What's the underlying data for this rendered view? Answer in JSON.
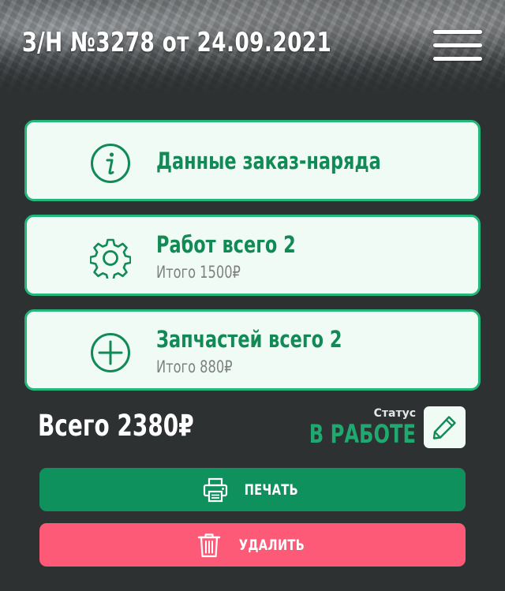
{
  "header": {
    "title": "З/Н №3278 от 24.09.2021",
    "menu_icon": "hamburger-menu-icon"
  },
  "cards": [
    {
      "title": "Данные заказ-наряда",
      "subtitle": "",
      "icon": "info-icon"
    },
    {
      "title": "Работ всего 2",
      "subtitle": "Итого 1500₽",
      "icon": "gear-icon"
    },
    {
      "title": "Запчастей всего 2",
      "subtitle": "Итого 880₽",
      "icon": "plus-circle-icon"
    }
  ],
  "summary": {
    "total": "Всего 2380₽",
    "status_label": "Статус",
    "status_value": "В РАБОТЕ",
    "edit_icon": "pencil-icon"
  },
  "actions": {
    "print_label": "ПЕЧАТЬ",
    "print_icon": "printer-icon",
    "delete_label": "УДАЛИТЬ",
    "delete_icon": "trash-icon"
  },
  "colors": {
    "background": "#2d3132",
    "accent_green": "#128a56",
    "card_border": "#24b77b",
    "card_background": "#f1fbf6",
    "status_green": "#1fa86f",
    "print_button": "#0f915e",
    "delete_button": "#fd5a78"
  }
}
